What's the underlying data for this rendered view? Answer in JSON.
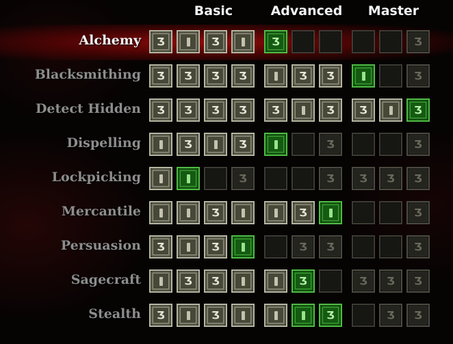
{
  "headers": {
    "basic": "Basic",
    "advanced": "Advanced",
    "master": "Master"
  },
  "colors": {
    "owned_tile": "#6e6e5c",
    "learned_tile": "#1d6e19",
    "available_tile": "#2b2b24",
    "empty_tile": "#1b1b17",
    "selected_band": "#960a0a",
    "selected_label": "#f4f4f4",
    "label": "#8d8d8d"
  },
  "glyph_legend": {
    "R": "rune-icon",
    "B": "bar-icon"
  },
  "state_legend": {
    "o": "owned",
    "g": "learned",
    "d": "available",
    "e": "empty"
  },
  "skills": [
    {
      "name": "Alchemy",
      "selected": true,
      "tiles": [
        "oR",
        "oB",
        "oR",
        "oB",
        "gR",
        "eN",
        "eN",
        "eN",
        "eN",
        "dR"
      ]
    },
    {
      "name": "Blacksmithing",
      "selected": false,
      "tiles": [
        "oR",
        "oR",
        "oR",
        "oR",
        "oB",
        "oR",
        "oR",
        "gB",
        "eN",
        "dR"
      ]
    },
    {
      "name": "Detect Hidden",
      "selected": false,
      "tiles": [
        "oR",
        "oR",
        "oR",
        "oR",
        "oR",
        "oB",
        "oR",
        "oR",
        "oB",
        "gR"
      ]
    },
    {
      "name": "Dispelling",
      "selected": false,
      "tiles": [
        "oB",
        "oR",
        "oB",
        "oR",
        "gB",
        "eN",
        "dR",
        "eN",
        "eN",
        "dR"
      ]
    },
    {
      "name": "Lockpicking",
      "selected": false,
      "tiles": [
        "oB",
        "gB",
        "eN",
        "dR",
        "eN",
        "eN",
        "dR",
        "dR",
        "dR",
        "dR"
      ]
    },
    {
      "name": "Mercantile",
      "selected": false,
      "tiles": [
        "oB",
        "oB",
        "oR",
        "oB",
        "oB",
        "oR",
        "gB",
        "eN",
        "eN",
        "dR"
      ]
    },
    {
      "name": "Persuasion",
      "selected": false,
      "tiles": [
        "oR",
        "oB",
        "oR",
        "gB",
        "eN",
        "dR",
        "dR",
        "eN",
        "eN",
        "dR"
      ]
    },
    {
      "name": "Sagecraft",
      "selected": false,
      "tiles": [
        "oB",
        "oR",
        "oR",
        "oB",
        "oB",
        "gR",
        "eN",
        "dR",
        "dR",
        "dR"
      ]
    },
    {
      "name": "Stealth",
      "selected": false,
      "tiles": [
        "oR",
        "oB",
        "oR",
        "oB",
        "oB",
        "gB",
        "gR",
        "eN",
        "dR",
        "dR"
      ]
    }
  ]
}
